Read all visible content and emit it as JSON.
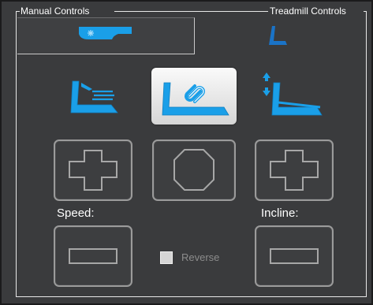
{
  "groups": {
    "manual_label": "Manual Controls",
    "treadmill_label": "Treadmill Controls"
  },
  "tabs": [
    {
      "icon": "treadmill-fan-icon",
      "selected": true
    },
    {
      "icon": "treadmill-side-icon",
      "selected": false
    }
  ],
  "modes": [
    {
      "icon": "treadmill-speed-icon",
      "active": false
    },
    {
      "icon": "treadmill-link-icon",
      "active": true
    },
    {
      "icon": "treadmill-incline-icon",
      "active": false
    }
  ],
  "controls": {
    "speed_label": "Speed:",
    "incline_label": "Incline:",
    "reverse_label": "Reverse",
    "reverse_checked": false
  },
  "colors": {
    "panel": "#3a3b3d",
    "accent": "#1a9fe8",
    "button_border": "#9b9b9b"
  }
}
